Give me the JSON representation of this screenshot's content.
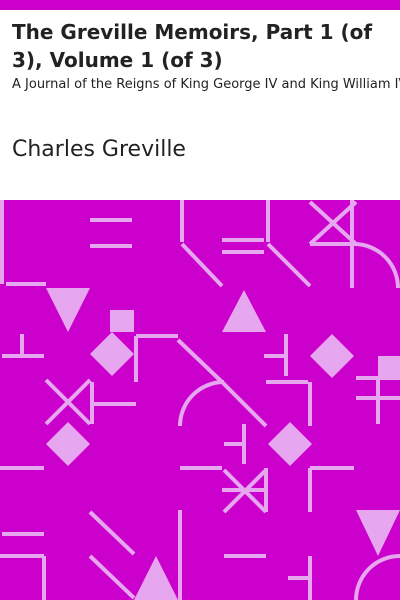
{
  "book": {
    "title": "The Greville Memoirs, Part 1 (of 3), Volume 1 (of 3)",
    "subtitle": "A Journal of the Reigns of King George IV and King William IV",
    "author": "Charles Greville"
  },
  "colors": {
    "accent": "#cc00cc",
    "pattern_background": "#cc00cc",
    "pattern_shape": "#e6a6f0",
    "text": "#222222",
    "header_background": "#ffffff"
  }
}
